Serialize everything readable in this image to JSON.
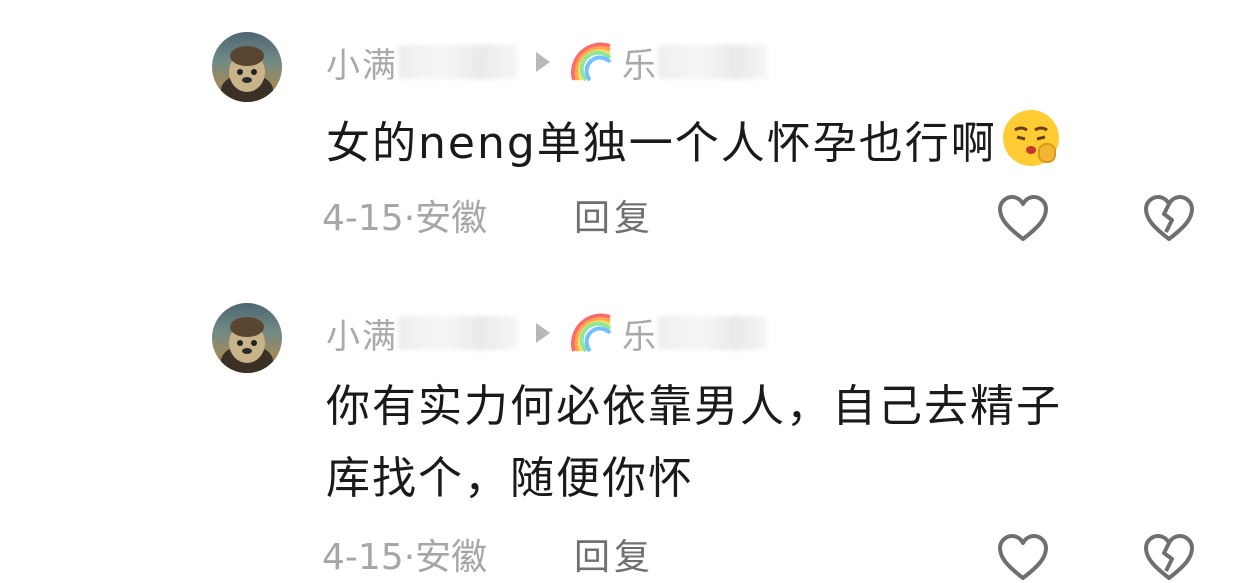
{
  "comments": [
    {
      "username_visible": "小满",
      "reply_to_visible": "乐",
      "text": "女的neng单独一个人怀孕也行啊",
      "emoji": "shushing-face-emoji",
      "date_location": "4-15·安徽",
      "reply_label": "回复",
      "like_icon": "heart-outline-icon",
      "dislike_icon": "broken-heart-icon"
    },
    {
      "username_visible": "小满",
      "reply_to_visible": "乐",
      "text_line1": "你有实力何必依靠男人，自己去精子",
      "text_line2": "库找个，随便你怀",
      "date_location": "4-15·安徽",
      "reply_label": "回复",
      "like_icon": "heart-outline-icon",
      "dislike_icon": "broken-heart-icon"
    }
  ],
  "colors": {
    "meta_gray": "#a6a6a6",
    "text_dark": "#1a1a1a",
    "icon_gray": "#6f6f6f"
  }
}
